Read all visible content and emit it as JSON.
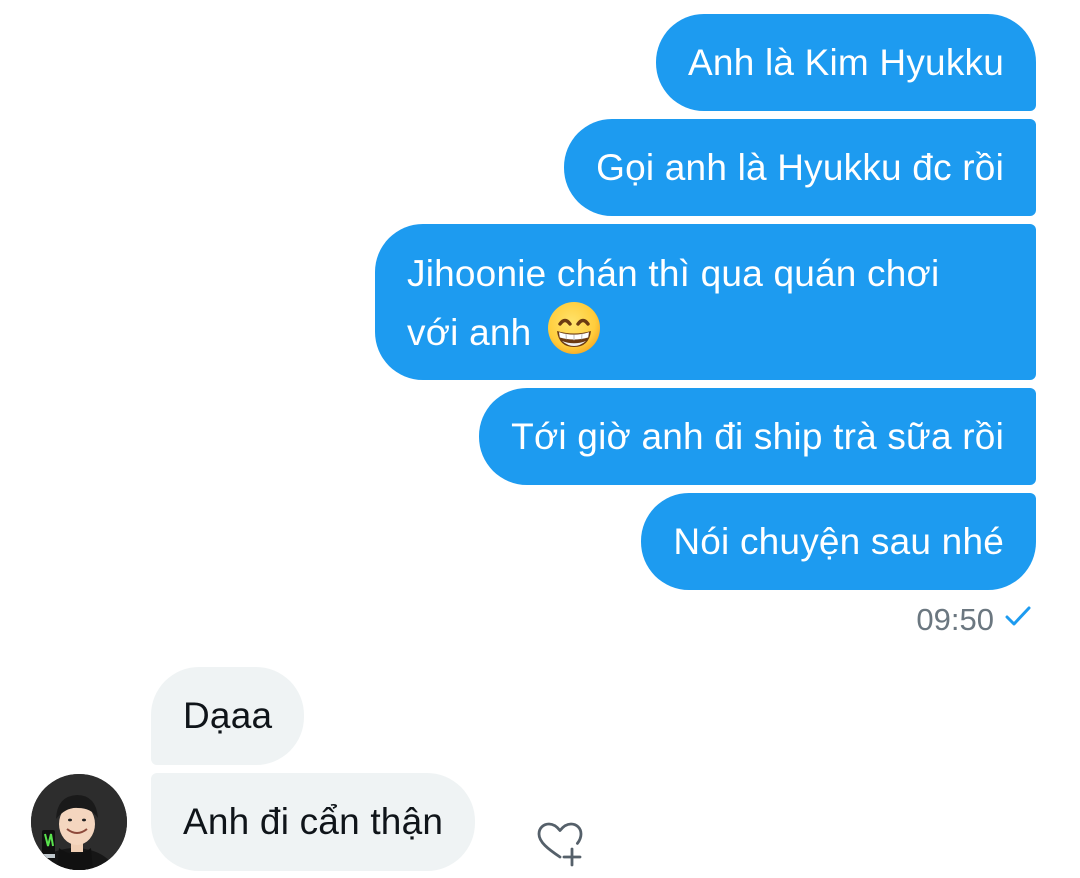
{
  "conversation": {
    "outgoing": [
      {
        "text": "Anh là Kim Hyukku"
      },
      {
        "text": "Gọi anh là Hyukku đc rồi"
      },
      {
        "line1": "Jihoonie chán thì qua quán chơi",
        "line2": "với anh",
        "emoji": "grinning-face-with-smiling-eyes"
      },
      {
        "text": "Tới giờ anh đi ship trà sữa rồi"
      },
      {
        "text": "Nói chuyện sau nhé"
      }
    ],
    "timestamp": "09:50",
    "status_icon": "sent-check-icon",
    "incoming": [
      {
        "text": "Dạaa"
      },
      {
        "text": "Anh đi cẩn thận"
      }
    ]
  },
  "icons": {
    "react": "heart-plus-icon",
    "avatar": "avatar"
  },
  "colors": {
    "outgoing_bubble": "#1d9bf0",
    "incoming_bubble": "#eff3f4",
    "outgoing_text": "#ffffff",
    "incoming_text": "#0f1419",
    "timestamp": "#6b7780",
    "check": "#1d9bf0"
  }
}
